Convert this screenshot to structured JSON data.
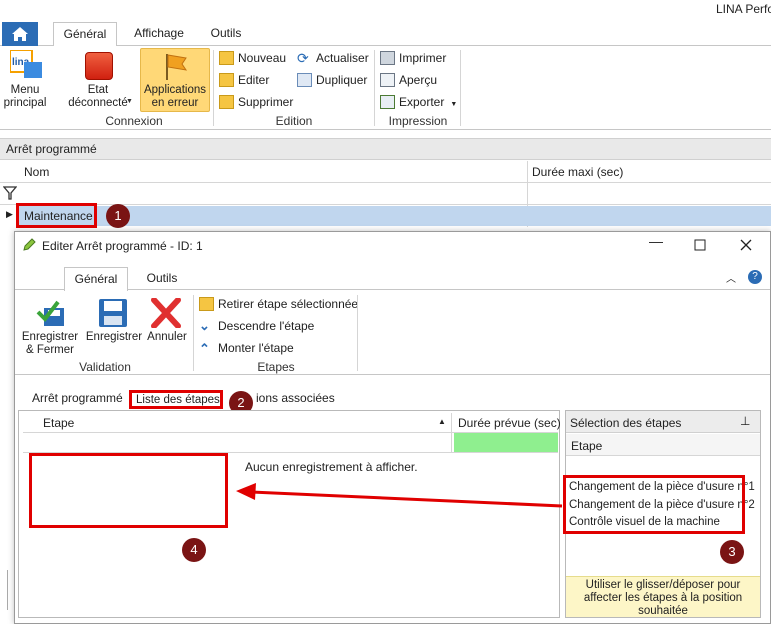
{
  "app": {
    "title": "LINA Perfo"
  },
  "ribbon": {
    "tabs": [
      "Général",
      "Affichage",
      "Outils"
    ],
    "menu_principal": "Menu\nprincipal",
    "etat": "Etat\ndéconnecté",
    "applications": "Applications\nen erreur",
    "connexion_group": "Connexion",
    "nouveau": "Nouveau",
    "editer": "Editer",
    "supprimer": "Supprimer",
    "actualiser": "Actualiser",
    "dupliquer": "Dupliquer",
    "edition_group": "Edition",
    "imprimer": "Imprimer",
    "apercu": "Aperçu",
    "exporter": "Exporter",
    "impression_group": "Impression"
  },
  "main_grid": {
    "group_title": "Arrêt programmé",
    "col_nom": "Nom",
    "col_duree": "Durée maxi (sec)",
    "row_value": "Maintenance"
  },
  "dialog": {
    "title": "Editer Arrêt programmé - ID: 1",
    "tabs": [
      "Général",
      "Outils"
    ],
    "enregistrer_fermer": "Enregistrer\n& Fermer",
    "enregistrer": "Enregistrer",
    "annuler": "Annuler",
    "validation_group": "Validation",
    "retirer": "Retirer étape sélectionnée",
    "descendre": "Descendre l'étape",
    "monter": "Monter l'étape",
    "etapes_group": "Etapes",
    "page_tabs": [
      "Arrêt programmé",
      "Liste des étapes",
      "ions associées"
    ],
    "col_etape": "Etape",
    "col_duree_prevue": "Durée prévue (sec)",
    "empty_text": "Aucun enregistrement à afficher.",
    "selection_title": "Sélection des étapes",
    "selection_col": "Etape",
    "selection_items": [
      "Changement de la pièce d'usure n°1",
      "Changement de la pièce d'usure n°2",
      "Contrôle visuel de la machine"
    ],
    "hint": "Utiliser le glisser/déposer pour affecter les étapes à la position souhaitée"
  },
  "annotations": [
    "1",
    "2",
    "3",
    "4"
  ],
  "colors": {
    "accent": "#1e6fc4",
    "annotation": "#e00000",
    "selected_row": "#c0d6ee"
  }
}
